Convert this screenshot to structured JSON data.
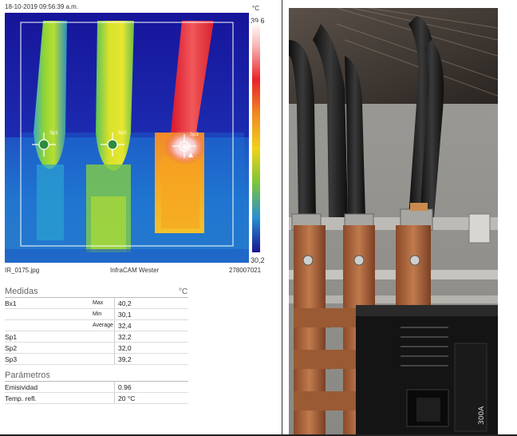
{
  "header": {
    "timestamp": "18-10-2019 09:56:39 a.m.",
    "unit": "°C"
  },
  "scale": {
    "max": "39,6",
    "min": "30,2"
  },
  "footer": {
    "filename": "IR_0175.jpg",
    "camera": "InfraCAM Wester",
    "serial": "278007021"
  },
  "spots": [
    {
      "id": "Sp1",
      "color": "#2e8b3a"
    },
    {
      "id": "Sp2",
      "color": "#2e8b3a"
    },
    {
      "id": "Sp3",
      "color": "#ffffff"
    }
  ],
  "measurements": {
    "title": "Medidas",
    "unit": "°C",
    "rows": [
      {
        "label": "Bx1",
        "sub": "Max",
        "value": "40,2"
      },
      {
        "label": "",
        "sub": "Min",
        "value": "30,1"
      },
      {
        "label": "",
        "sub": "Average",
        "value": "32,4"
      },
      {
        "label": "Sp1",
        "sub": "",
        "value": "32,2"
      },
      {
        "label": "Sp2",
        "sub": "",
        "value": "32,0"
      },
      {
        "label": "Sp3",
        "sub": "",
        "value": "39,2"
      }
    ]
  },
  "parameters": {
    "title": "Parámetros",
    "rows": [
      {
        "label": "Emisividad",
        "value": "0.96"
      },
      {
        "label": "Temp. refl.",
        "value": "20 °C"
      }
    ]
  },
  "photo": {
    "breaker_rating": "300A"
  },
  "colors": {
    "background_ir": "#0a1f9c",
    "hot": "#e8232a",
    "warm": "#f0d21a",
    "cool": "#7cc43a",
    "copper": "#b06a3c",
    "cable": "#1a1a1a"
  }
}
